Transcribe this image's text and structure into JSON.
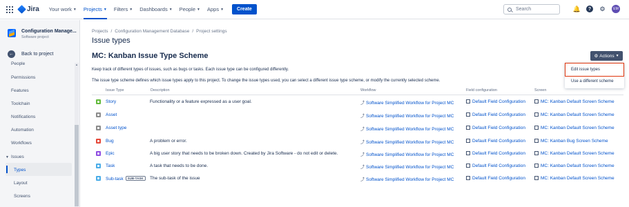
{
  "colors": {
    "primary": "#0052cc",
    "sidebar_bg": "#f4f5f7",
    "highlight_border": "#de350b"
  },
  "topnav": {
    "logo": "Jira",
    "items": [
      {
        "label": "Your work",
        "active": false
      },
      {
        "label": "Projects",
        "active": true
      },
      {
        "label": "Filters",
        "active": false
      },
      {
        "label": "Dashboards",
        "active": false
      },
      {
        "label": "People",
        "active": false
      },
      {
        "label": "Apps",
        "active": false
      }
    ],
    "create_label": "Create",
    "search_placeholder": "Search",
    "avatar_initials": "EM",
    "icons": [
      "notifications-icon",
      "help-icon",
      "settings-icon"
    ]
  },
  "sidebar": {
    "project_name": "Configuration Manage...",
    "project_type": "Software project",
    "back_label": "Back to project",
    "items": [
      {
        "label": "People"
      },
      {
        "label": "Permissions"
      },
      {
        "label": "Features"
      },
      {
        "label": "Toolchain"
      },
      {
        "label": "Notifications"
      },
      {
        "label": "Automation"
      },
      {
        "label": "Workflows"
      },
      {
        "label": "Issues",
        "group": true
      },
      {
        "label": "Types",
        "active": true
      },
      {
        "label": "Layout"
      },
      {
        "label": "Screens"
      }
    ]
  },
  "main": {
    "breadcrumb": [
      "Projects",
      "Configuration Management Database",
      "Project settings"
    ],
    "title": "Issue types",
    "scheme_title": "MC: Kanban Issue Type Scheme",
    "actions_label": "Actions",
    "desc1": "Keep track of different types of issues, such as bugs or tasks. Each issue type can be configured differently.",
    "desc2": "The issue type scheme defines which issue types apply to this project. To change the issue types used, you can select a different issue type scheme, or modify the currently selected scheme.",
    "dropdown": [
      "Edit issue types",
      "Use a different scheme"
    ],
    "columns": [
      "Issue Type",
      "Description",
      "Workflow",
      "Field configuration",
      "Screen"
    ],
    "rows": [
      {
        "name": "Story",
        "badge": "",
        "color": "#63ba3c",
        "desc": "Functionality or a feature expressed as a user goal.",
        "workflow": "Software Simplified Workflow for Project MC",
        "field": "Default Field Configuration",
        "screen": "MC: Kanban Default Screen Scheme"
      },
      {
        "name": "Asset",
        "badge": "",
        "color": "#8c8c8c",
        "desc": "",
        "workflow": "Software Simplified Workflow for Project MC",
        "field": "Default Field Configuration",
        "screen": "MC: Kanban Default Screen Scheme"
      },
      {
        "name": "Asset type",
        "badge": "",
        "color": "#8c8c8c",
        "desc": "",
        "workflow": "Software Simplified Workflow for Project MC",
        "field": "Default Field Configuration",
        "screen": "MC: Kanban Default Screen Scheme"
      },
      {
        "name": "Bug",
        "badge": "",
        "color": "#e5493a",
        "desc": "A problem or error.",
        "workflow": "Software Simplified Workflow for Project MC",
        "field": "Default Field Configuration",
        "screen": "MC: Kanban Bug Screen Scheme"
      },
      {
        "name": "Epic",
        "badge": "",
        "color": "#904ee2",
        "desc": "A big user story that needs to be broken down. Created by Jira Software - do not edit or delete.",
        "workflow": "Software Simplified Workflow for Project MC",
        "field": "Default Field Configuration",
        "screen": "MC: Kanban Default Screen Scheme"
      },
      {
        "name": "Task",
        "badge": "",
        "color": "#4bade8",
        "desc": "A task that needs to be done.",
        "workflow": "Software Simplified Workflow for Project MC",
        "field": "Default Field Configuration",
        "screen": "MC: Kanban Default Screen Scheme"
      },
      {
        "name": "Sub-task",
        "badge": "SUB-TASK",
        "color": "#4bade8",
        "desc": "The sub-task of the issue",
        "workflow": "Software Simplified Workflow for Project MC",
        "field": "Default Field Configuration",
        "screen": "MC: Kanban Default Screen Scheme"
      }
    ]
  }
}
